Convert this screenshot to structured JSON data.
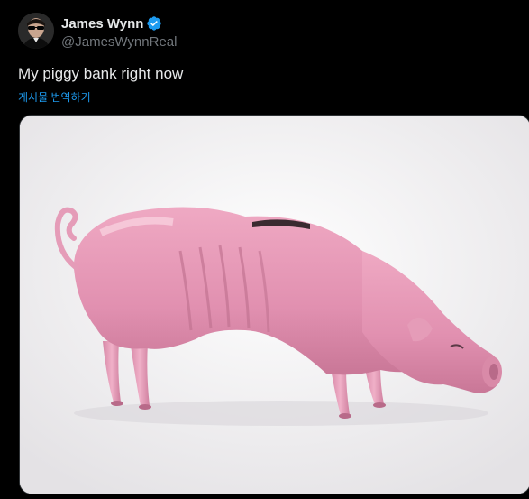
{
  "tweet": {
    "author": {
      "display_name": "James Wynn",
      "handle": "@JamesWynnReal",
      "verified": true,
      "avatar_icon": "avatar-photo"
    },
    "text": "My piggy bank right now",
    "translate_label": "게시물 번역하기",
    "media": {
      "alt": "Emaciated pink piggy bank",
      "accent_color": "#e89ab5"
    }
  },
  "colors": {
    "background": "#000000",
    "text_primary": "#e7e9ea",
    "text_secondary": "#71767b",
    "link": "#1d9bf0",
    "verified_badge": "#1d9bf0"
  }
}
